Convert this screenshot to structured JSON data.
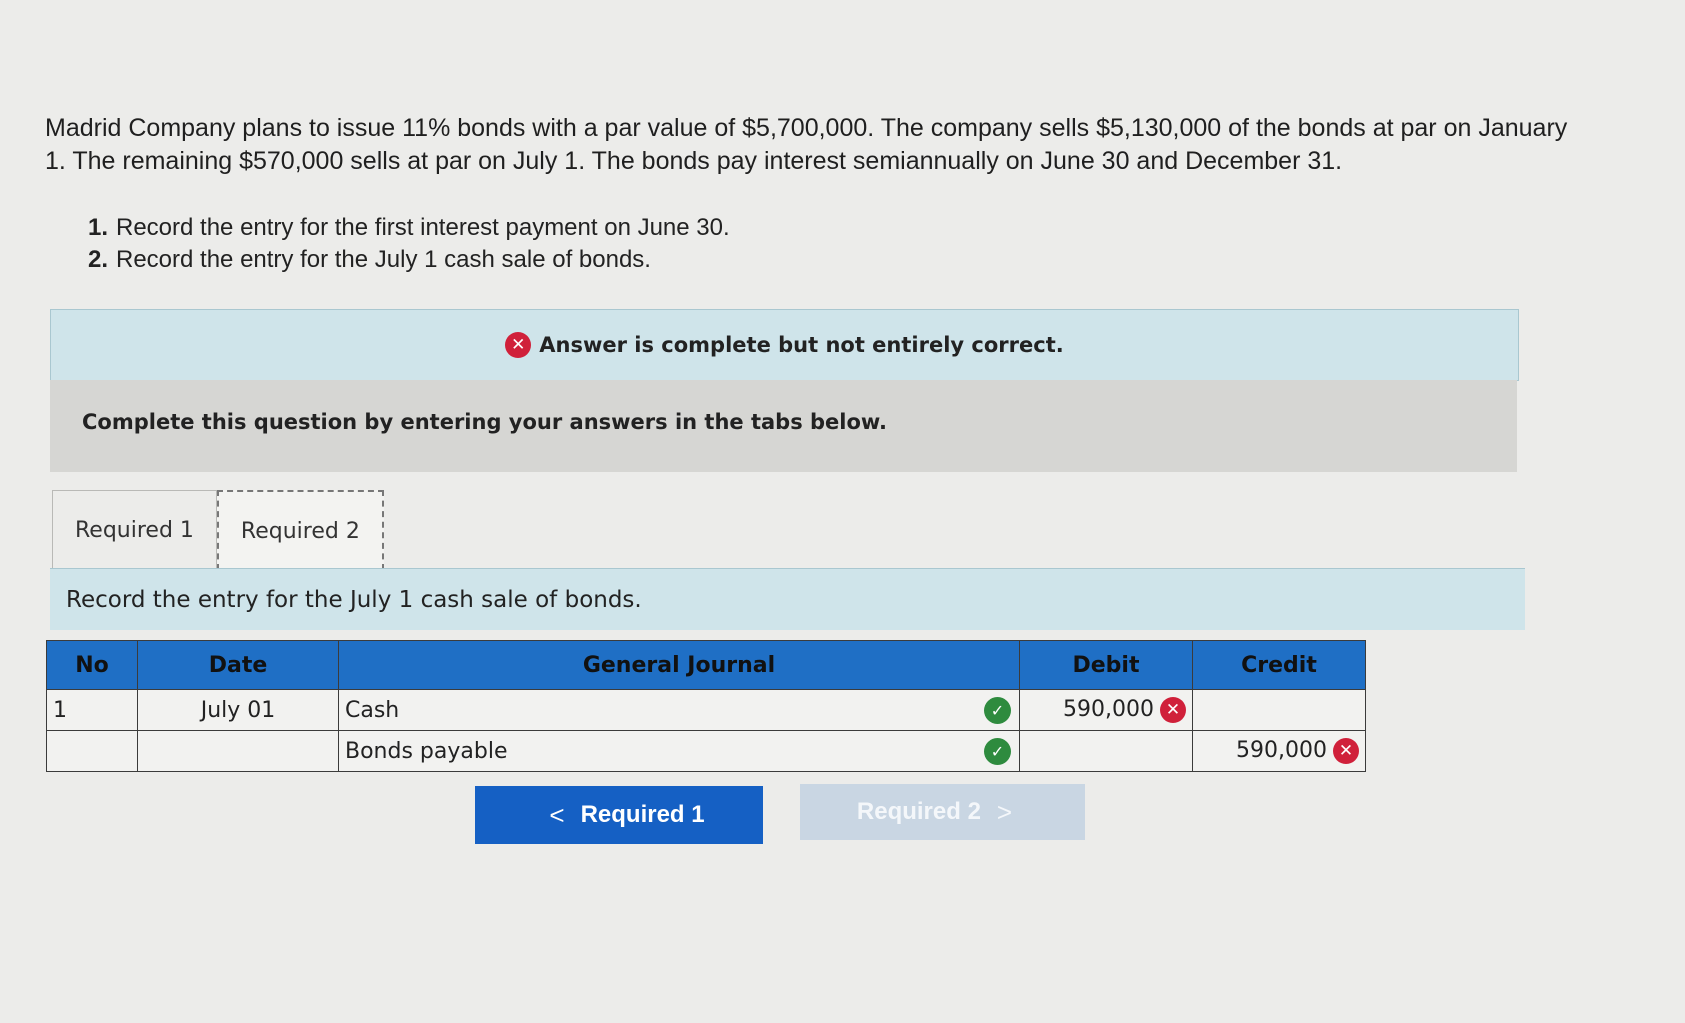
{
  "question": {
    "text": "Madrid Company plans to issue 11% bonds with a par value of $5,700,000. The company sells $5,130,000 of the bonds at par on January 1. The remaining $570,000 sells at par on July 1. The bonds pay interest semiannually on June 30 and December 31.",
    "steps": [
      {
        "num": "1.",
        "text": "Record the entry for the first interest payment on June 30."
      },
      {
        "num": "2.",
        "text": "Record the entry for the July 1 cash sale of bonds."
      }
    ]
  },
  "feedback": {
    "icon": "x-circle-icon",
    "text": "Answer is complete but not entirely correct."
  },
  "instruction": "Complete this question by entering your answers in the tabs below.",
  "tabs": [
    {
      "label": "Required 1",
      "active": false
    },
    {
      "label": "Required 2",
      "active": true
    }
  ],
  "prompt": "Record the entry for the July 1 cash sale of bonds.",
  "journal": {
    "headers": {
      "no": "No",
      "date": "Date",
      "account": "General Journal",
      "debit": "Debit",
      "credit": "Credit"
    },
    "rows": [
      {
        "no": "1",
        "date": "July 01",
        "account": "Cash",
        "account_status": "correct",
        "debit": "590,000",
        "debit_status": "incorrect",
        "credit": "",
        "credit_status": ""
      },
      {
        "no": "",
        "date": "",
        "account": "Bonds payable",
        "account_status": "correct",
        "debit": "",
        "debit_status": "",
        "credit": "590,000",
        "credit_status": "incorrect"
      }
    ]
  },
  "nav": {
    "prev_label": "Required 1",
    "next_label": "Required 2"
  },
  "colors": {
    "header_blue": "#1f6fc5",
    "button_blue": "#1560c4",
    "error_red": "#d0203a",
    "check_green": "#2e8b3e",
    "feedback_bg": "#cfe4ea"
  }
}
